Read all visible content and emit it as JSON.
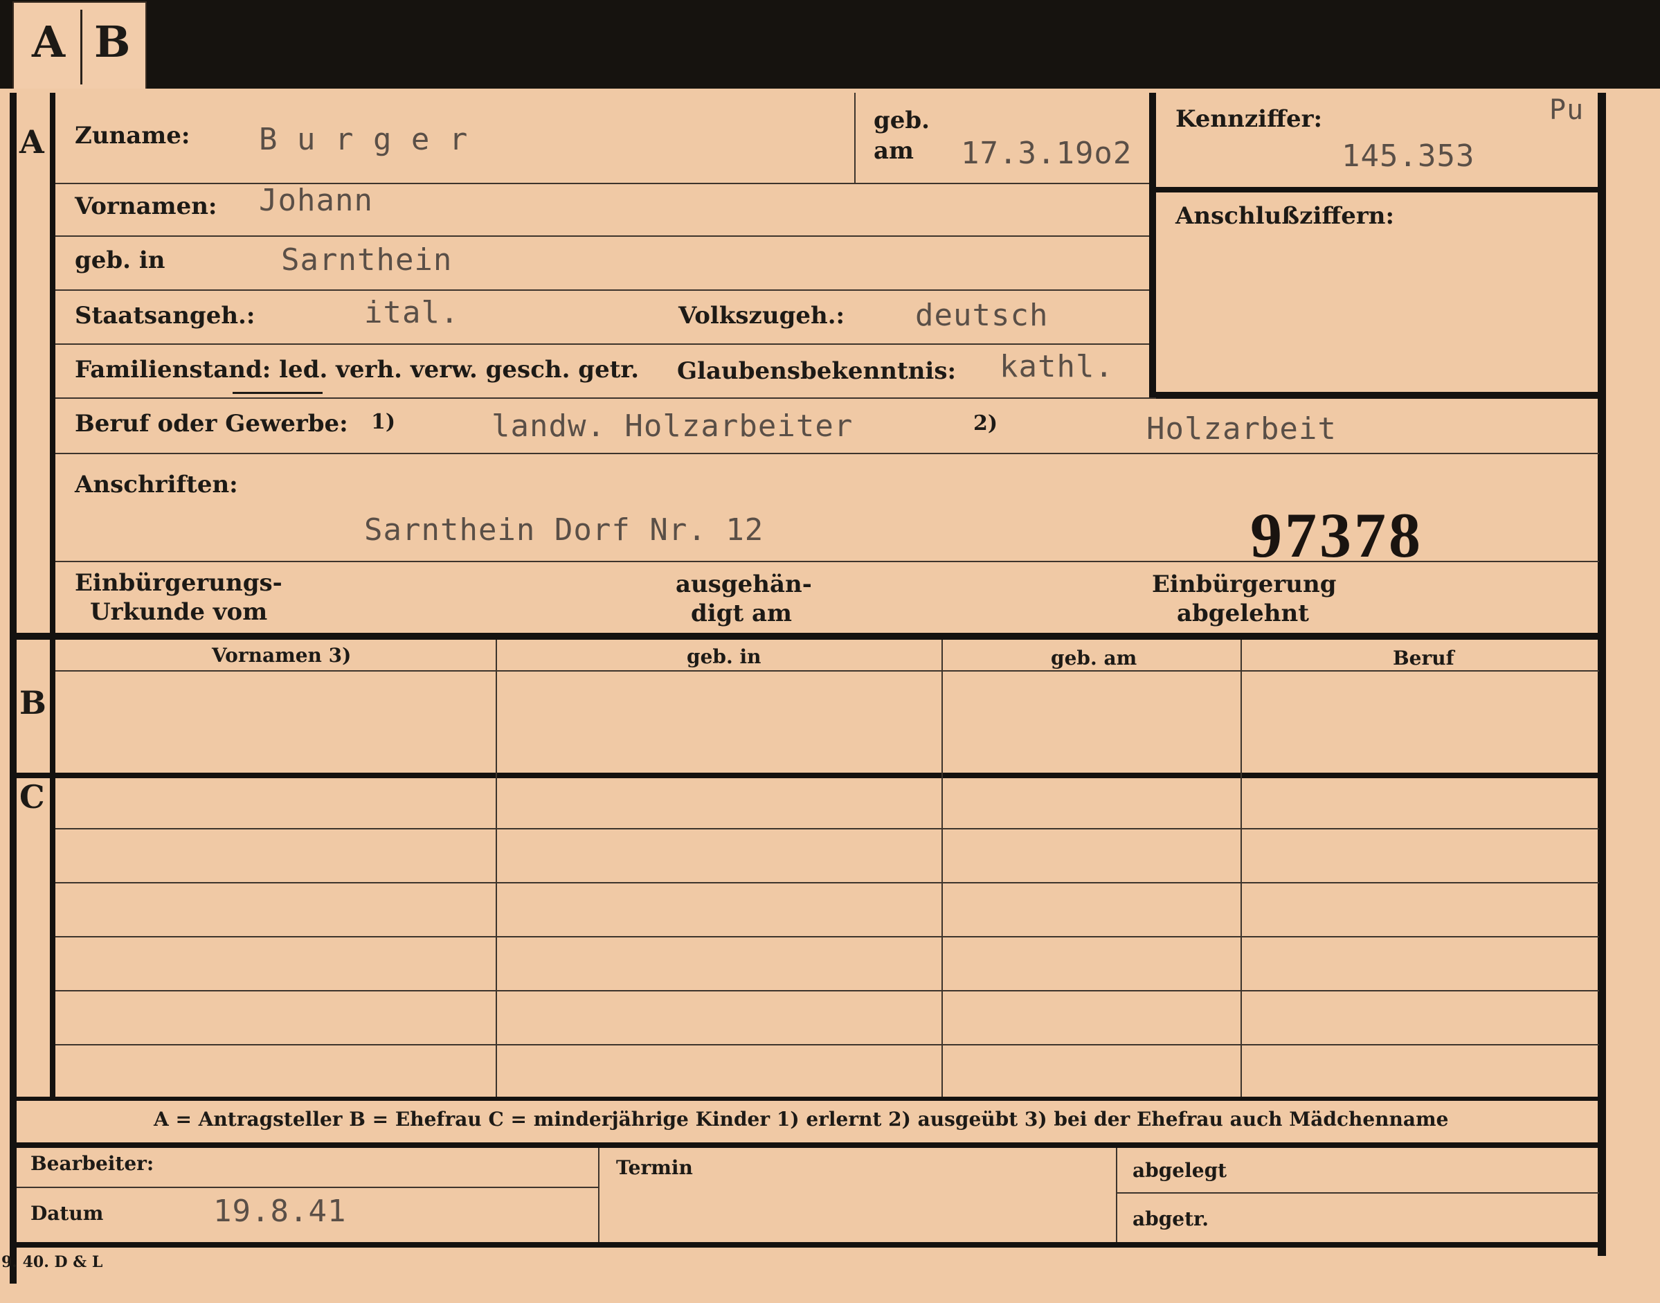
{
  "tabs": [
    "A",
    "B"
  ],
  "section_letters": {
    "a": "A",
    "b": "B",
    "c": "C"
  },
  "header": {
    "zuname_label": "Zuname:",
    "zuname_value": "B u r g e r",
    "geb_label": "geb.",
    "am_label": "am",
    "geb_am_value": "17.3.19o2",
    "kennziffer_label": "Kennziffer:",
    "kennziffer_value": "145.353",
    "kennziffer_note": "Pu",
    "anschluss_label": "Anschlußziffern:"
  },
  "fields": {
    "vornamen_label": "Vornamen:",
    "vornamen_value": "Johann",
    "geb_in_label": "geb. in",
    "geb_in_value": "Sarnthein",
    "staatsangeh_label": "Staatsangeh.:",
    "staatsangeh_value": "ital.",
    "volkszugeh_label": "Volkszugeh.:",
    "volkszugeh_value": "deutsch",
    "familienstand_label": "Familienstand: led. verh. verw. gesch. getr.",
    "glauben_label": "Glaubensbekenntnis:",
    "glauben_value": "kathl.",
    "beruf_label": "Beruf oder Gewerbe:",
    "beruf_fn1": "1)",
    "beruf_value1": "landw. Holzarbeiter",
    "beruf_fn2": "2)",
    "beruf_value2": "Holzarbeit",
    "anschriften_label": "Anschriften:",
    "anschriften_value": "Sarnthein Dorf Nr. 12",
    "stamp_number": "97378",
    "einb_urkunde_line1": "Einbürgerungs-",
    "einb_urkunde_line2": "Urkunde vom",
    "ausgehaend_line1": "ausgehän-",
    "ausgehaend_line2": "digt am",
    "einb_abgelehnt_line1": "Einbürgerung",
    "einb_abgelehnt_line2": "abgelehnt"
  },
  "table": {
    "headers": [
      "Vornamen 3)",
      "geb. in",
      "geb. am",
      "Beruf"
    ]
  },
  "legend": "A = Antragsteller   B = Ehefrau   C = minderjährige Kinder   1) erlernt   2) ausgeübt   3) bei der Ehefrau auch Mädchenname",
  "footer": {
    "bearbeiter_label": "Bearbeiter:",
    "datum_label": "Datum",
    "datum_value": "19.8.41",
    "termin_label": "Termin",
    "abgelegt_label": "abgelegt",
    "abgetr_label": "abgetr."
  },
  "print_code": "9. 40. D & L"
}
